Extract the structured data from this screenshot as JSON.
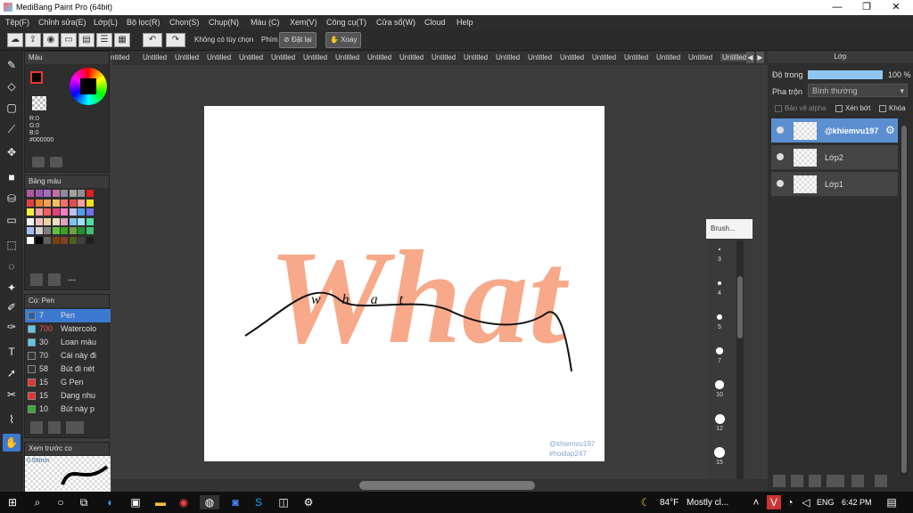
{
  "window": {
    "title": "MediBang Paint Pro (64bit)",
    "min": "—",
    "max": "❐",
    "close": "✕"
  },
  "menu": [
    "Tệp(F)",
    "Chỉnh sửa(E)",
    "Lớp(L)",
    "Bộ lọc(R)",
    "Chọn(S)",
    "Chụp(N)",
    "Màu (C)",
    "Xem(V)",
    "Công cụ(T)",
    "Cửa sổ(W)",
    "Cloud",
    "Help"
  ],
  "toolbar": {
    "no_option": "Không có tùy chọn",
    "key_label": "Phím",
    "reset": "Đặt lại",
    "rotate": "Xoay"
  },
  "tabs": [
    "ntitled",
    "Untitled",
    "Untitled",
    "Untitled",
    "Untitled",
    "Untitled",
    "Untitled",
    "Untitled",
    "Untitled",
    "Untitled",
    "Untitled",
    "Untitled",
    "Untitled",
    "Untitled",
    "Untitled",
    "Untitled",
    "Untitled",
    "Untitled",
    "Untitled",
    "Untitled"
  ],
  "color_panel": {
    "title": "Màu",
    "r": "R:0",
    "g": "G:0",
    "b": "B:0",
    "hex": "#000000"
  },
  "palette_panel": {
    "title": "Bảng màu",
    "footer": "---"
  },
  "brush_panel": {
    "title": "Cọ: Pen",
    "items": [
      {
        "size": "7",
        "name": "Pen",
        "color": "#2a5ea8",
        "selected": true
      },
      {
        "size": "700",
        "name": "Watercolor",
        "color": "#5cc8e8",
        "selected": false
      },
      {
        "size": "30",
        "name": "Loan màu",
        "color": "#5cc8e8",
        "selected": false
      },
      {
        "size": "70",
        "name": "Cái này đi",
        "color": "#333333",
        "selected": false
      },
      {
        "size": "58",
        "name": "Bút đi nét",
        "color": "#333333",
        "selected": false
      },
      {
        "size": "15",
        "name": "G Pen",
        "color": "#e83030",
        "selected": false
      },
      {
        "size": "15",
        "name": "Dạng nhu",
        "color": "#e83030",
        "selected": false
      },
      {
        "size": "10",
        "name": "Bút này p",
        "color": "#30b030",
        "selected": false
      }
    ]
  },
  "preview_panel": {
    "title": "Xem trước co",
    "size": "0.59mm"
  },
  "canvas": {
    "watermark1": "@khiemvu197",
    "watermark2": "#hoidap247",
    "word_big": "What",
    "word_small": "what"
  },
  "brush_size": {
    "title": "Brush...",
    "sizes": [
      "3",
      "4",
      "5",
      "7",
      "10",
      "12",
      "15"
    ]
  },
  "layer_panel": {
    "title": "Lớp",
    "opacity_label": "Độ trong",
    "opacity_value": "100 %",
    "blend_label": "Pha trộn",
    "blend_value": "Bình thường",
    "protect_alpha": "Bảo vệ alpha",
    "clip": "Xén bớt",
    "lock": "Khóa",
    "layers": [
      {
        "name": "@khiemvu197",
        "selected": true
      },
      {
        "name": "Lớp2",
        "selected": false
      },
      {
        "name": "Lớp1",
        "selected": false
      }
    ]
  },
  "taskbar": {
    "weather_temp": "84°F",
    "weather_text": "Mostly cl...",
    "lang": "ENG",
    "time": "6:42 PM"
  }
}
